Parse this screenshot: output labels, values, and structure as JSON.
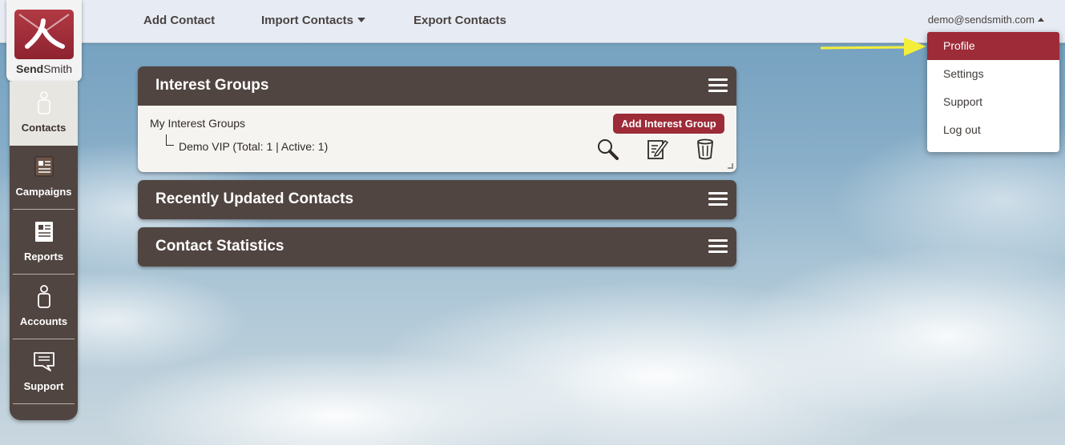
{
  "app": {
    "logo_text_bold": "Send",
    "logo_text_regular": "Smith"
  },
  "topnav": {
    "add_contact": "Add Contact",
    "import_contacts": "Import Contacts",
    "export_contacts": "Export Contacts"
  },
  "user": {
    "email": "demo@sendsmith.com"
  },
  "user_menu": {
    "items": [
      "Profile",
      "Settings",
      "Support",
      "Log out"
    ],
    "active": "Profile"
  },
  "sidebar": {
    "items": [
      {
        "label": "Contacts",
        "icon": "person-icon",
        "active": true
      },
      {
        "label": "Campaigns",
        "icon": "newsletter-icon",
        "active": false
      },
      {
        "label": "Reports",
        "icon": "report-icon",
        "active": false
      },
      {
        "label": "Accounts",
        "icon": "person-icon",
        "active": false
      },
      {
        "label": "Support",
        "icon": "speech-bubble-icon",
        "active": false
      }
    ]
  },
  "panels": {
    "interest_groups": {
      "title": "Interest Groups",
      "root_label": "My Interest Groups",
      "child_label": "Demo VIP (Total: 1 | Active: 1)",
      "add_button": "Add Interest Group"
    },
    "recently_updated": {
      "title": "Recently Updated Contacts"
    },
    "contact_statistics": {
      "title": "Contact Statistics"
    }
  },
  "colors": {
    "brand_red": "#9d2b38",
    "panel_brown": "#514541",
    "annotation_yellow": "#f4ee3a"
  }
}
